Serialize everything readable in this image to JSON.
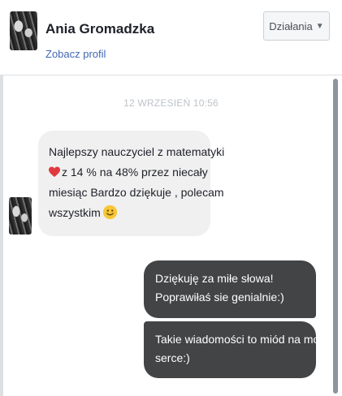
{
  "header": {
    "name": "Ania Gromadzka",
    "profile_link": "Zobacz profil",
    "action_label": "Działania"
  },
  "conversation": {
    "timestamp": "12 WRZESIEŃ 10:56",
    "incoming": {
      "lines": [
        "Najlepszy nauczyciel z matematyki",
        "z 14 % na 48% przez  niecały",
        "miesiąc Bardzo dziękuje , polecam",
        "wszystkim"
      ]
    },
    "outgoing": [
      {
        "lines": [
          "Dziękuję za miłe słowa!",
          "Poprawiłaś sie genialnie:)"
        ]
      },
      {
        "lines": [
          "Takie wiadomości to miód na moje",
          "serce:)"
        ]
      }
    ]
  },
  "icons": {
    "heart": "heart-emoji-icon",
    "smiley": "smiley-emoji-icon",
    "caret": "chevron-down-icon"
  },
  "colors": {
    "link": "#4267b2",
    "outgoing_bubble": "#424446",
    "incoming_bubble": "#f1f0f0",
    "heart": "#e0393e",
    "smiley": "#f7c734"
  }
}
